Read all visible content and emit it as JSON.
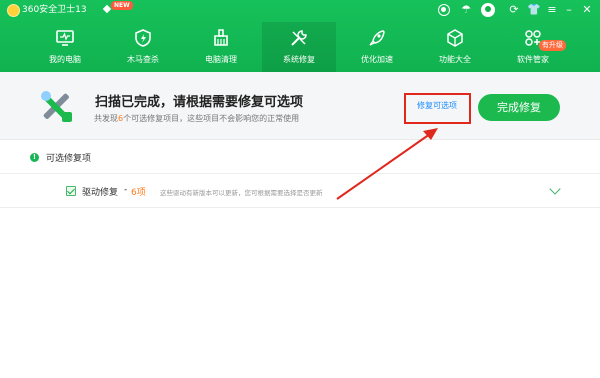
{
  "app": {
    "title": "360安全卫士13",
    "new_badge": "NEW"
  },
  "titlebar_icons": [
    "shield-status-icon",
    "weather-icon",
    "user-avatar-icon",
    "theme-icon",
    "shirt-skin-icon",
    "menu-icon",
    "minimize-icon",
    "close-icon"
  ],
  "nav": {
    "items": [
      {
        "label": "我的电脑",
        "icon": "monitor-icon"
      },
      {
        "label": "木马查杀",
        "icon": "shield-bolt-icon"
      },
      {
        "label": "电脑清理",
        "icon": "broom-icon"
      },
      {
        "label": "系统修复",
        "icon": "wrench-icon",
        "active": true
      },
      {
        "label": "优化加速",
        "icon": "rocket-icon"
      },
      {
        "label": "功能大全",
        "icon": "cube-icon"
      },
      {
        "label": "软件管家",
        "icon": "apps-icon"
      }
    ],
    "upgrade_badge": "有升级"
  },
  "banner": {
    "title": "扫描已完成，请根据需要修复可选项",
    "sub_prefix": "共发现",
    "sub_count": "6",
    "sub_suffix": "个可选修复项目，这些项目不会影响您的正常使用",
    "optional_link": "修复可选项",
    "fix_button": "完成修复"
  },
  "section": {
    "info_mark": "!",
    "title": "可选修复项"
  },
  "rows": [
    {
      "title": "驱动修复",
      "sep": "-",
      "count": "6项",
      "desc": "这些驱动有新版本可以更新，您可根据需要选择是否更新"
    }
  ],
  "colors": {
    "brand_green": "#10b24f",
    "button_green": "#1cba4e",
    "link_blue": "#1a8cff",
    "highlight_red": "#e0281c",
    "count_orange": "#ff7b1c"
  }
}
